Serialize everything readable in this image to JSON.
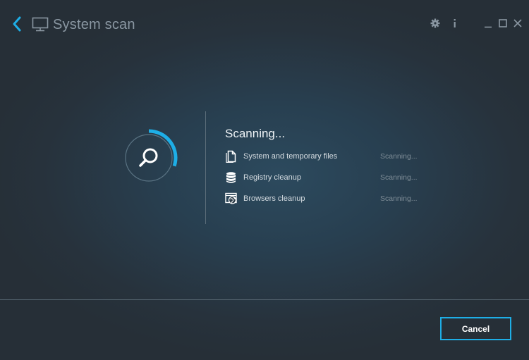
{
  "window": {
    "title": "System scan"
  },
  "icons": {
    "back": "chevron-left-icon",
    "monitor": "monitor-icon",
    "settings": "gear-icon",
    "info": "info-icon",
    "minimize": "minimize-icon",
    "maximize": "maximize-icon",
    "close": "close-icon",
    "search": "search-icon"
  },
  "colors": {
    "accent": "#1eaee6",
    "background": "#27323c",
    "title_text": "#8a97a2",
    "status_text": "#7e8c96"
  },
  "scan": {
    "heading": "Scanning...",
    "progress_fraction": 0.3,
    "items": [
      {
        "label": "System and temporary files",
        "status": "Scanning...",
        "icon": "document-icon"
      },
      {
        "label": "Registry cleanup",
        "status": "Scanning...",
        "icon": "database-icon"
      },
      {
        "label": "Browsers cleanup",
        "status": "Scanning...",
        "icon": "browser-globe-icon"
      }
    ]
  },
  "footer": {
    "cancel_label": "Cancel"
  }
}
